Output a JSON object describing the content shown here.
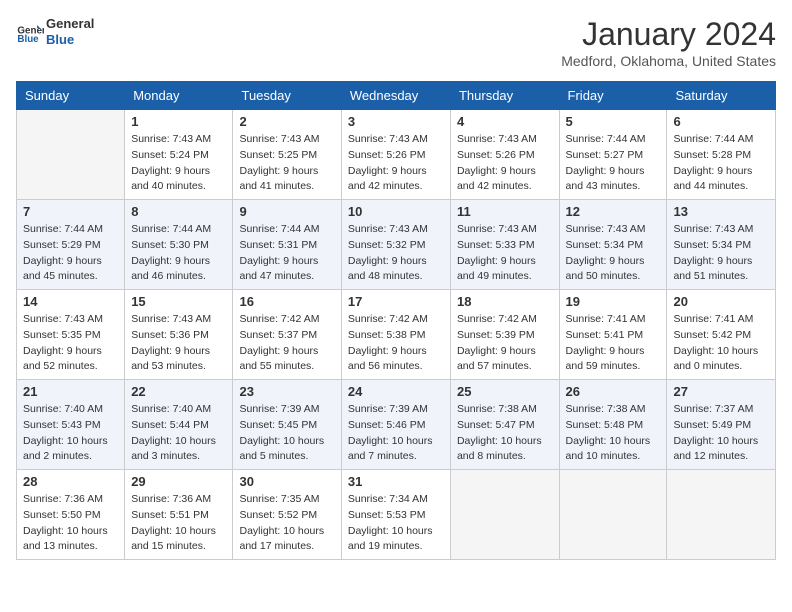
{
  "header": {
    "logo": {
      "general": "General",
      "blue": "Blue"
    },
    "title": "January 2024",
    "location": "Medford, Oklahoma, United States"
  },
  "weekdays": [
    "Sunday",
    "Monday",
    "Tuesday",
    "Wednesday",
    "Thursday",
    "Friday",
    "Saturday"
  ],
  "weeks": [
    [
      {
        "day": "",
        "sunrise": "",
        "sunset": "",
        "daylight": ""
      },
      {
        "day": "1",
        "sunrise": "Sunrise: 7:43 AM",
        "sunset": "Sunset: 5:24 PM",
        "daylight": "Daylight: 9 hours and 40 minutes."
      },
      {
        "day": "2",
        "sunrise": "Sunrise: 7:43 AM",
        "sunset": "Sunset: 5:25 PM",
        "daylight": "Daylight: 9 hours and 41 minutes."
      },
      {
        "day": "3",
        "sunrise": "Sunrise: 7:43 AM",
        "sunset": "Sunset: 5:26 PM",
        "daylight": "Daylight: 9 hours and 42 minutes."
      },
      {
        "day": "4",
        "sunrise": "Sunrise: 7:43 AM",
        "sunset": "Sunset: 5:26 PM",
        "daylight": "Daylight: 9 hours and 42 minutes."
      },
      {
        "day": "5",
        "sunrise": "Sunrise: 7:44 AM",
        "sunset": "Sunset: 5:27 PM",
        "daylight": "Daylight: 9 hours and 43 minutes."
      },
      {
        "day": "6",
        "sunrise": "Sunrise: 7:44 AM",
        "sunset": "Sunset: 5:28 PM",
        "daylight": "Daylight: 9 hours and 44 minutes."
      }
    ],
    [
      {
        "day": "7",
        "sunrise": "Sunrise: 7:44 AM",
        "sunset": "Sunset: 5:29 PM",
        "daylight": "Daylight: 9 hours and 45 minutes."
      },
      {
        "day": "8",
        "sunrise": "Sunrise: 7:44 AM",
        "sunset": "Sunset: 5:30 PM",
        "daylight": "Daylight: 9 hours and 46 minutes."
      },
      {
        "day": "9",
        "sunrise": "Sunrise: 7:44 AM",
        "sunset": "Sunset: 5:31 PM",
        "daylight": "Daylight: 9 hours and 47 minutes."
      },
      {
        "day": "10",
        "sunrise": "Sunrise: 7:43 AM",
        "sunset": "Sunset: 5:32 PM",
        "daylight": "Daylight: 9 hours and 48 minutes."
      },
      {
        "day": "11",
        "sunrise": "Sunrise: 7:43 AM",
        "sunset": "Sunset: 5:33 PM",
        "daylight": "Daylight: 9 hours and 49 minutes."
      },
      {
        "day": "12",
        "sunrise": "Sunrise: 7:43 AM",
        "sunset": "Sunset: 5:34 PM",
        "daylight": "Daylight: 9 hours and 50 minutes."
      },
      {
        "day": "13",
        "sunrise": "Sunrise: 7:43 AM",
        "sunset": "Sunset: 5:34 PM",
        "daylight": "Daylight: 9 hours and 51 minutes."
      }
    ],
    [
      {
        "day": "14",
        "sunrise": "Sunrise: 7:43 AM",
        "sunset": "Sunset: 5:35 PM",
        "daylight": "Daylight: 9 hours and 52 minutes."
      },
      {
        "day": "15",
        "sunrise": "Sunrise: 7:43 AM",
        "sunset": "Sunset: 5:36 PM",
        "daylight": "Daylight: 9 hours and 53 minutes."
      },
      {
        "day": "16",
        "sunrise": "Sunrise: 7:42 AM",
        "sunset": "Sunset: 5:37 PM",
        "daylight": "Daylight: 9 hours and 55 minutes."
      },
      {
        "day": "17",
        "sunrise": "Sunrise: 7:42 AM",
        "sunset": "Sunset: 5:38 PM",
        "daylight": "Daylight: 9 hours and 56 minutes."
      },
      {
        "day": "18",
        "sunrise": "Sunrise: 7:42 AM",
        "sunset": "Sunset: 5:39 PM",
        "daylight": "Daylight: 9 hours and 57 minutes."
      },
      {
        "day": "19",
        "sunrise": "Sunrise: 7:41 AM",
        "sunset": "Sunset: 5:41 PM",
        "daylight": "Daylight: 9 hours and 59 minutes."
      },
      {
        "day": "20",
        "sunrise": "Sunrise: 7:41 AM",
        "sunset": "Sunset: 5:42 PM",
        "daylight": "Daylight: 10 hours and 0 minutes."
      }
    ],
    [
      {
        "day": "21",
        "sunrise": "Sunrise: 7:40 AM",
        "sunset": "Sunset: 5:43 PM",
        "daylight": "Daylight: 10 hours and 2 minutes."
      },
      {
        "day": "22",
        "sunrise": "Sunrise: 7:40 AM",
        "sunset": "Sunset: 5:44 PM",
        "daylight": "Daylight: 10 hours and 3 minutes."
      },
      {
        "day": "23",
        "sunrise": "Sunrise: 7:39 AM",
        "sunset": "Sunset: 5:45 PM",
        "daylight": "Daylight: 10 hours and 5 minutes."
      },
      {
        "day": "24",
        "sunrise": "Sunrise: 7:39 AM",
        "sunset": "Sunset: 5:46 PM",
        "daylight": "Daylight: 10 hours and 7 minutes."
      },
      {
        "day": "25",
        "sunrise": "Sunrise: 7:38 AM",
        "sunset": "Sunset: 5:47 PM",
        "daylight": "Daylight: 10 hours and 8 minutes."
      },
      {
        "day": "26",
        "sunrise": "Sunrise: 7:38 AM",
        "sunset": "Sunset: 5:48 PM",
        "daylight": "Daylight: 10 hours and 10 minutes."
      },
      {
        "day": "27",
        "sunrise": "Sunrise: 7:37 AM",
        "sunset": "Sunset: 5:49 PM",
        "daylight": "Daylight: 10 hours and 12 minutes."
      }
    ],
    [
      {
        "day": "28",
        "sunrise": "Sunrise: 7:36 AM",
        "sunset": "Sunset: 5:50 PM",
        "daylight": "Daylight: 10 hours and 13 minutes."
      },
      {
        "day": "29",
        "sunrise": "Sunrise: 7:36 AM",
        "sunset": "Sunset: 5:51 PM",
        "daylight": "Daylight: 10 hours and 15 minutes."
      },
      {
        "day": "30",
        "sunrise": "Sunrise: 7:35 AM",
        "sunset": "Sunset: 5:52 PM",
        "daylight": "Daylight: 10 hours and 17 minutes."
      },
      {
        "day": "31",
        "sunrise": "Sunrise: 7:34 AM",
        "sunset": "Sunset: 5:53 PM",
        "daylight": "Daylight: 10 hours and 19 minutes."
      },
      {
        "day": "",
        "sunrise": "",
        "sunset": "",
        "daylight": ""
      },
      {
        "day": "",
        "sunrise": "",
        "sunset": "",
        "daylight": ""
      },
      {
        "day": "",
        "sunrise": "",
        "sunset": "",
        "daylight": ""
      }
    ]
  ]
}
